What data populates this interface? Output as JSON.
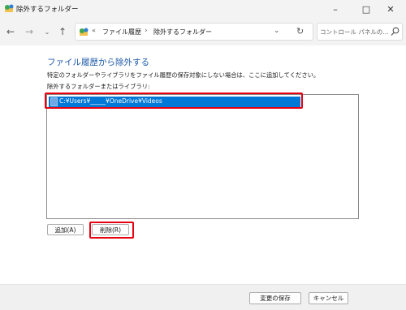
{
  "window": {
    "title": "除外するフォルダー",
    "icon": "control-panel-icon",
    "controls": {
      "minimize": "–",
      "maximize": "□",
      "close": "✕"
    }
  },
  "nav": {
    "back": "←",
    "forward": "→",
    "history": "⌄",
    "up": "↑"
  },
  "address": {
    "overflow": "«",
    "crumbs": [
      "ファイル履歴",
      "除外するフォルダー"
    ],
    "separator": "›",
    "dropdown": "⌄",
    "refresh": "↻"
  },
  "search": {
    "placeholder": "コントロール パネルの..."
  },
  "main": {
    "heading": "ファイル履歴から除外する",
    "description": "特定のフォルダーやライブラリをファイル履歴の保存対象にしない場合は、ここに追加してください。",
    "list_label": "除外するフォルダーまたはライブラリ:",
    "items": [
      {
        "path": "C:¥Users¥_____¥OneDrive¥Videos"
      }
    ],
    "add_button": "追加(A)",
    "remove_button": "削除(R)"
  },
  "footer": {
    "save_button": "変更の保存",
    "cancel_button": "キャンセル"
  },
  "colors": {
    "heading": "#1e5aa8",
    "selection": "#0078d7",
    "highlight": "#e60012"
  }
}
